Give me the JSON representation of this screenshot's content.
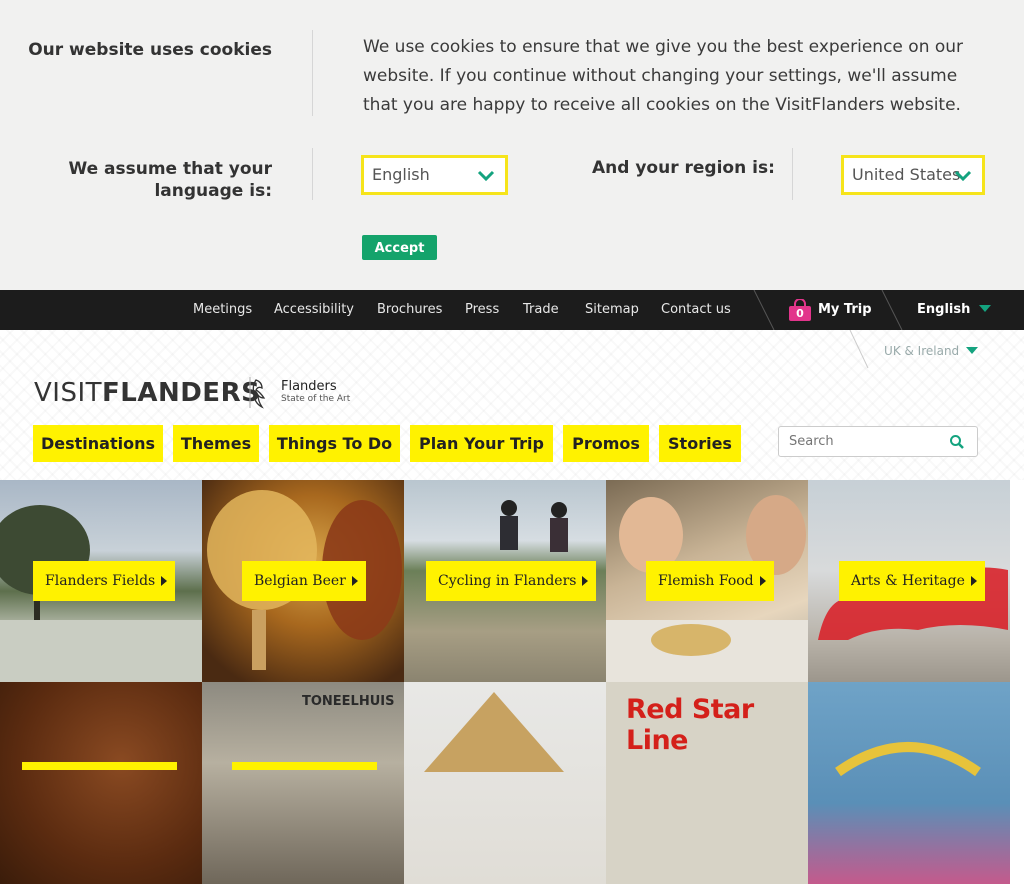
{
  "cookie": {
    "heading": "Our website uses cookies",
    "message": "We use cookies to ensure that we give you the best experience on our website. If you continue without changing your settings, we'll assume that you are happy to receive all cookies on the VisitFlanders website.",
    "language_label": "We assume that your language is:",
    "language_value": "English",
    "region_label": "And your region is:",
    "region_value": "United States",
    "accept_label": "Accept"
  },
  "topnav": {
    "links": [
      "Meetings",
      "Accessibility",
      "Brochures",
      "Press",
      "Trade",
      "Sitemap",
      "Contact us"
    ],
    "mytrip_count": "0",
    "mytrip_label": "My Trip",
    "language": "English",
    "region": "UK & Ireland"
  },
  "brand": {
    "logo_thin": "VISIT",
    "logo_bold": "FLANDERS",
    "flanders_name": "Flanders",
    "flanders_tagline": "State of the Art"
  },
  "mainnav": [
    "Destinations",
    "Themes",
    "Things To Do",
    "Plan Your Trip",
    "Promos",
    "Stories"
  ],
  "search": {
    "placeholder": "Search"
  },
  "tiles": [
    "Flanders Fields",
    "Belgian Beer",
    "Cycling in Flanders",
    "Flemish Food",
    "Arts & Heritage"
  ],
  "second_row": {
    "building_sign": "TONEELHUIS",
    "poster_text": "Red Star Line"
  },
  "colors": {
    "accent_yellow": "#fff200",
    "accept_green": "#14a36b",
    "chevron_green": "#14a37f",
    "mytrip_pink": "#e2358b"
  }
}
